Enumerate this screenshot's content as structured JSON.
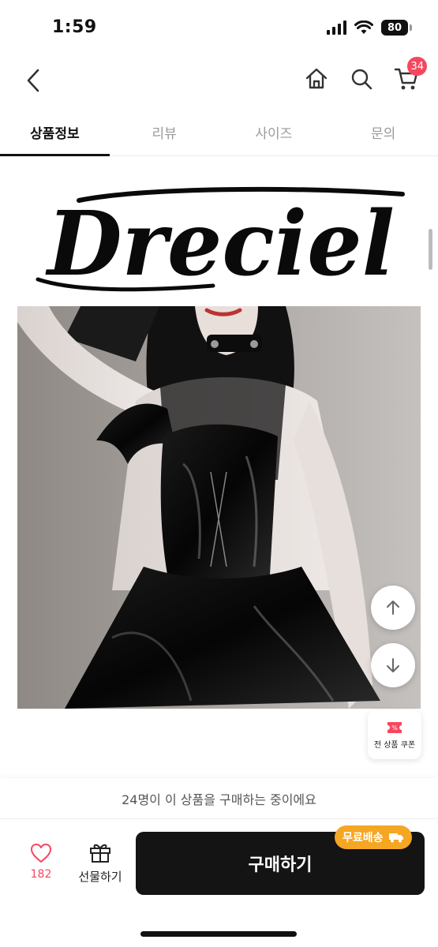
{
  "status": {
    "time": "1:59",
    "battery": "80"
  },
  "header": {
    "cart_count": "34"
  },
  "tabs": [
    {
      "label": "상품정보",
      "active": true
    },
    {
      "label": "리뷰",
      "active": false
    },
    {
      "label": "사이즈",
      "active": false
    },
    {
      "label": "문의",
      "active": false
    }
  ],
  "brand": {
    "logo_text": "Dreciel"
  },
  "coupon": {
    "label": "전 상품 쿠폰"
  },
  "bottom": {
    "buying_notice": "24명이 이 상품을 구매하는 중이에요",
    "like_count": "182",
    "gift_label": "선물하기",
    "buy_label": "구매하기",
    "free_shipping_label": "무료배송"
  },
  "colors": {
    "accent": "#f5485f",
    "buy_button": "#141414",
    "free_shipping": "#f5a623"
  }
}
